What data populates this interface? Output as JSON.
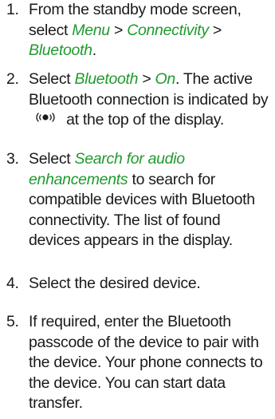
{
  "steps": [
    {
      "number": "1.",
      "text_a": "From the standby mode screen, select ",
      "menu_1": "Menu",
      "sep_1": " > ",
      "menu_2": "Connectivity",
      "sep_2": " > ",
      "menu_3": "Bluetooth",
      "end": "."
    },
    {
      "number": "2.",
      "text_a": "Select ",
      "menu_1": "Bluetooth",
      "sep_1": " > ",
      "menu_2": "On",
      "text_b": ". The active Bluetooth connection is indicated by",
      "icon": "bluetooth-active-icon",
      "text_c": "at the top of the display."
    },
    {
      "number": "3.",
      "text_a": "Select ",
      "menu_1": "Search for audio enhancements",
      "text_b": " to search for compatible devices with Bluetooth connectivity. The list of found devices appears in the display."
    },
    {
      "number": "4.",
      "text_a": "Select the desired device."
    },
    {
      "number": "5.",
      "text_a": "If required, enter the Bluetooth passcode of the device to pair with the device. Your phone connects to the device. You can start data transfer."
    }
  ],
  "colors": {
    "menu_text": "#1f9a2e",
    "body_text": "#1a1a1a"
  }
}
